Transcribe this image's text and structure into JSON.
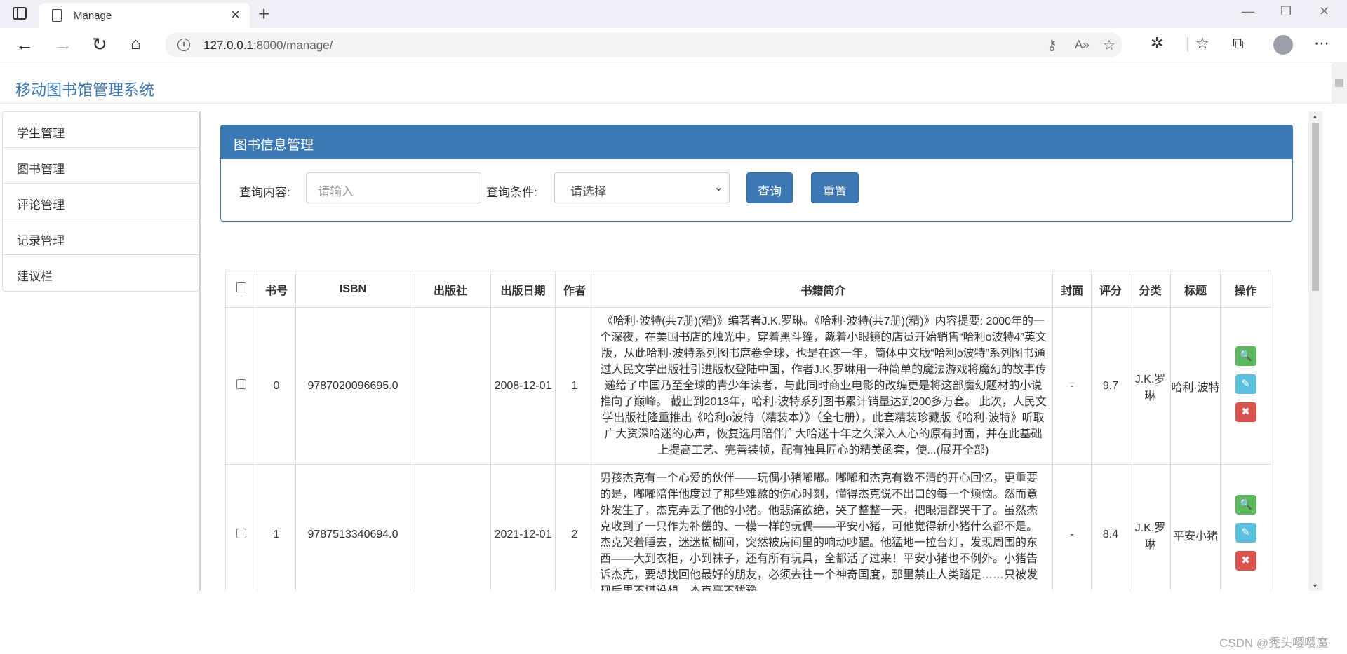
{
  "browser": {
    "tab_title": "Manage",
    "url_host": "127.0.0.1",
    "url_rest": ":8000/manage/",
    "new_tab": "+",
    "close": "×"
  },
  "app": {
    "title": "移动图书馆管理系统"
  },
  "sidebar": {
    "items": [
      {
        "label": "学生管理"
      },
      {
        "label": "图书管理"
      },
      {
        "label": "评论管理"
      },
      {
        "label": "记录管理"
      },
      {
        "label": "建议栏"
      }
    ]
  },
  "panel": {
    "title": "图书信息管理",
    "query_label": "查询内容:",
    "query_placeholder": "请输入",
    "condition_label": "查询条件:",
    "condition_value": "请选择",
    "search_button": "查询",
    "reset_button": "重置"
  },
  "table": {
    "columns": [
      "书号",
      "ISBN",
      "出版社",
      "出版日期",
      "作者",
      "书籍简介",
      "封面",
      "评分",
      "分类",
      "标题",
      "操作"
    ],
    "rows": [
      {
        "id": "0",
        "isbn": "9787020096695.0",
        "publisher": "",
        "date": "2008-12-01",
        "author": "1",
        "intro": "《哈利·波特(共7册)(精)》编著者J.K.罗琳。《哈利·波特(共7册)(精)》内容提要: 2000年的一个深夜，在美国书店的烛光中，穿着黑斗篷，戴着小眼镜的店员开始销售“哈利o波特4”英文版，从此哈利·波特系列图书席卷全球，也是在这一年，简体中文版“哈利o波特”系列图书通过人民文学出版社引进版权登陆中国，作者J.K.罗琳用一种简单的魔法游戏将魔幻的故事传递给了中国乃至全球的青少年读者，与此同时商业电影的改编更是将这部魔幻题材的小说推向了巅峰。 截止到2013年，哈利·波特系列图书累计销量达到200多万套。 此次，人民文学出版社隆重推出《哈利o波特（精装本）》（全七册），此套精装珍藏版《哈利·波特》听取广大资深哈迷的心声，恢复选用陪伴广大哈迷十年之久深入人心的原有封面，并在此基础上提高工艺、完善装帧，配有独具匠心的精美函套，使...(展开全部)",
        "cover": "-",
        "score": "9.7",
        "category": "J.K.罗琳",
        "title": "哈利·波特"
      },
      {
        "id": "1",
        "isbn": "9787513340694.0",
        "publisher": "",
        "date": "2021-12-01",
        "author": "2",
        "intro": "男孩杰克有一个心爱的伙伴——玩偶小猪嘟嘟。嘟嘟和杰克有数不清的开心回忆，更重要的是，嘟嘟陪伴他度过了那些难熬的伤心时刻，懂得杰克说不出口的每一个烦恼。然而意外发生了，杰克弄丢了他的小猪。他悲痛欲绝，哭了整整一天，把眼泪都哭干了。虽然杰克收到了一只作为补偿的、一模一样的玩偶——平安小猪，可他觉得新小猪什么都不是。 杰克哭着睡去，迷迷糊糊间，突然被房间里的响动吵醒。他猛地一拉台灯，发现周围的东西——大到衣柜，小到袜子，还有所有玩具，全都活了过来！平安小猪也不例外。小猪告诉杰克，要想找回他最好的朋友，必须去往一个神奇国度，那里禁止人类踏足……只被发现后果不堪设想。杰克毫不犹豫",
        "cover": "-",
        "score": "8.4",
        "category": "J.K.罗琳",
        "title": "平安小猪"
      }
    ],
    "actions": {
      "view": "🔍",
      "edit": "✎",
      "delete": "✖"
    }
  },
  "watermark": "CSDN @秃头嘤嘤魔",
  "colors": {
    "primary": "#3c78b5",
    "success": "#5cb85c",
    "info": "#5bc0de",
    "danger": "#d9534f"
  }
}
